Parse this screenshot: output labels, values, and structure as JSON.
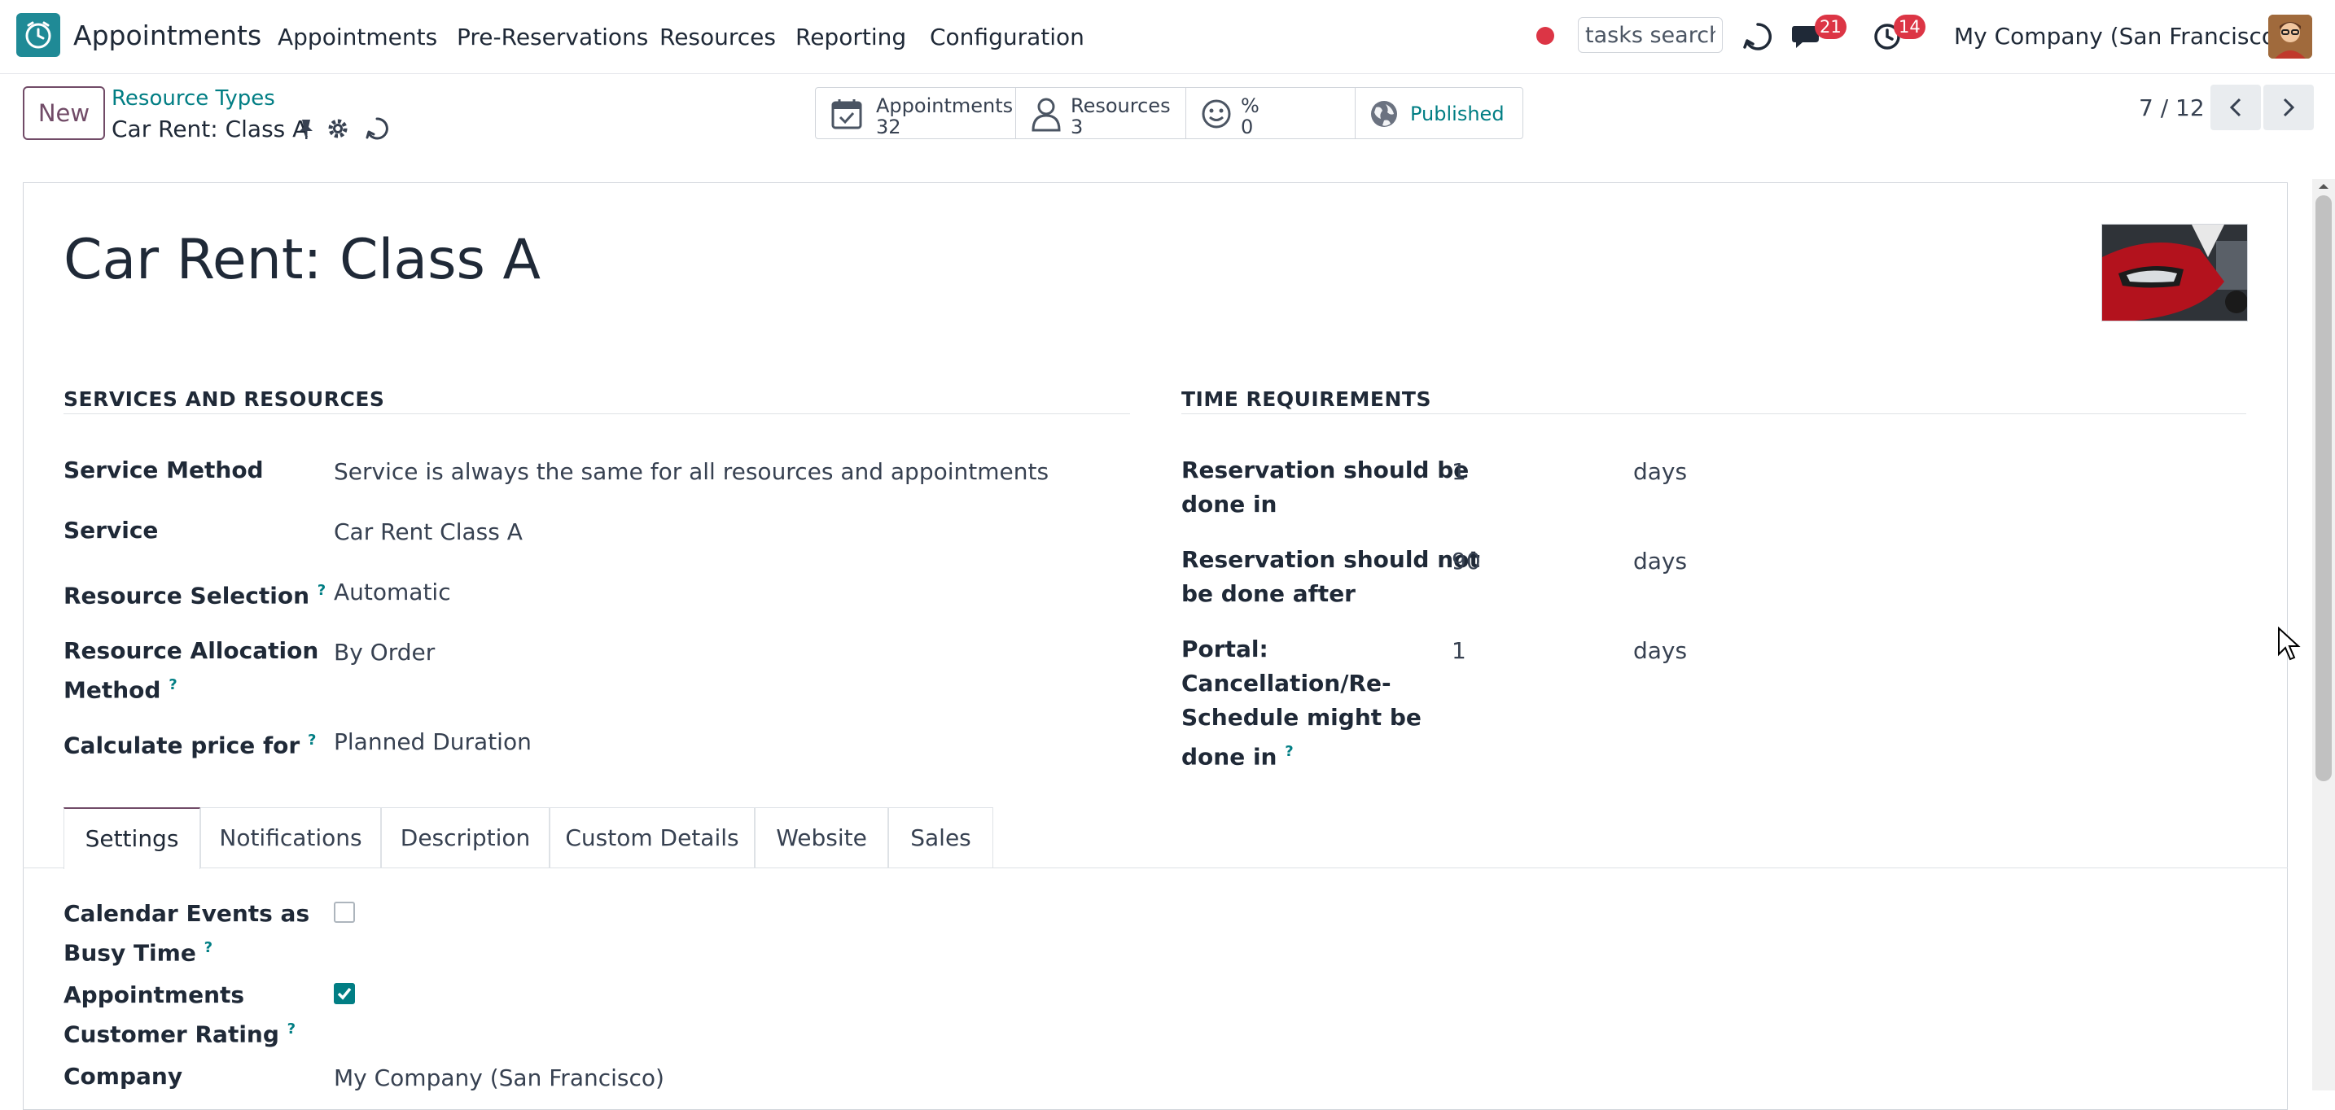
{
  "navbar": {
    "app_name": "Appointments",
    "menu": [
      "Appointments",
      "Pre-Reservations",
      "Resources",
      "Reporting",
      "Configuration"
    ],
    "search_value": "tasks search",
    "messages_count": "21",
    "activities_count": "14",
    "company": "My Company (San Francisco)"
  },
  "control": {
    "new_label": "New",
    "breadcrumb": "Resource Types",
    "record_name": "Car Rent: Class A",
    "stats": [
      {
        "label": "Appointments",
        "value": "32"
      },
      {
        "label": "Resources",
        "value": "3"
      },
      {
        "label": "%",
        "value": "0"
      },
      {
        "label": "Published",
        "value": ""
      }
    ],
    "pager": "7 / 12"
  },
  "form": {
    "title": "Car Rent: Class A",
    "services_section": "SERVICES AND RESOURCES",
    "time_section": "TIME REQUIREMENTS",
    "services_fields": [
      {
        "label": "Service Method",
        "value": "Service is always the same for all resources and appointments"
      },
      {
        "label": "Service",
        "value": "Car Rent Class A"
      },
      {
        "label": "Resource Selection",
        "value": "Automatic"
      },
      {
        "label_line1": "Resource Allocation",
        "label_line2": "Method",
        "value": "By Order"
      },
      {
        "label": "Calculate price for",
        "value": "Planned Duration"
      }
    ],
    "time_fields": [
      {
        "line1": "Reservation should be",
        "line2": "done in",
        "value": "1",
        "unit": "days"
      },
      {
        "line1": "Reservation should not",
        "line2": "be done after",
        "value": "90",
        "unit": "days"
      },
      {
        "line1": "Portal:",
        "line2": "Cancellation/Re-",
        "line3": "Schedule might be",
        "line4": "done in",
        "value": "1",
        "unit": "days"
      }
    ],
    "tabs": [
      "Settings",
      "Notifications",
      "Description",
      "Custom Details",
      "Website",
      "Sales"
    ],
    "settings": [
      {
        "line1": "Calendar Events as",
        "line2": "Busy Time",
        "checked": false
      },
      {
        "line1": "Appointments",
        "line2": "Customer Rating",
        "checked": true
      }
    ],
    "company_label": "Company",
    "company_value": "My Company (San Francisco)"
  },
  "colors": {
    "brand": "#714b67",
    "link": "#017e84",
    "badge": "#dc3545"
  }
}
